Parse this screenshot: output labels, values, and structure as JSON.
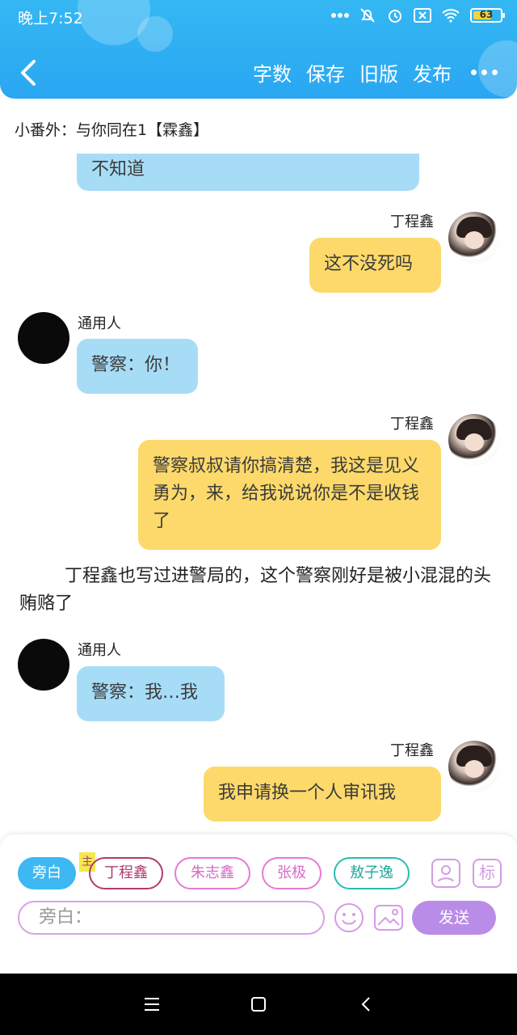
{
  "status": {
    "time": "晚上7:52",
    "battery": "63"
  },
  "nav": {
    "actions": [
      "字数",
      "保存",
      "旧版",
      "发布"
    ]
  },
  "story_title": "小番外：与你同在1【霖鑫】",
  "messages": {
    "m0": "不知道",
    "m1_speaker": "丁程鑫",
    "m1": "这不没死吗",
    "m2_speaker": "通用人",
    "m2": "警察：你！",
    "m3_speaker": "丁程鑫",
    "m3": "警察叔叔请你搞清楚，我这是见义勇为，来，给我说说你是不是收钱了",
    "narration": "丁程鑫也写过进警局的，这个警察刚好是被小混混的头贿赂了",
    "m4_speaker": "通用人",
    "m4": "警察：我…我",
    "m5_speaker": "丁程鑫",
    "m5": "我申请换一个人审讯我"
  },
  "panel": {
    "chips": [
      "旁白",
      "丁程鑫",
      "朱志鑫",
      "张极",
      "敖子逸"
    ],
    "main_tag": "主",
    "mark_label": "标",
    "input_placeholder": "旁白：",
    "send_label": "发送"
  },
  "colors": {
    "accent": "#34b8f3",
    "left_bubble": "#a7dcf7",
    "right_bubble": "#fcd96a",
    "send": "#b98ce8"
  }
}
